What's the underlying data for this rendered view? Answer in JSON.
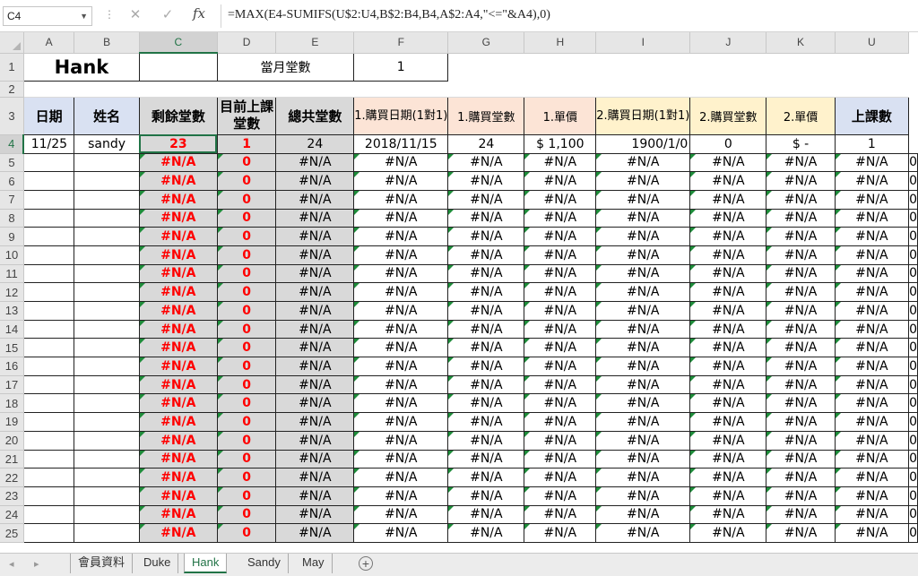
{
  "name_box": "C4",
  "formula": "=MAX(E4-SUMIFS(U$2:U4,B$2:B4,B4,A$2:A4,\"<=\"&A4),0)",
  "fx_label": "fx",
  "column_headers": [
    "A",
    "B",
    "C",
    "D",
    "E",
    "F",
    "G",
    "H",
    "I",
    "J",
    "K",
    "U"
  ],
  "row_numbers": [
    "1",
    "2",
    "3",
    "4",
    "5",
    "6",
    "7",
    "8",
    "9",
    "10",
    "11",
    "12",
    "13",
    "14",
    "15",
    "16",
    "17",
    "18",
    "19",
    "20",
    "21",
    "22",
    "23",
    "24",
    "25"
  ],
  "row1": {
    "name": "Hank",
    "label": "當月堂數",
    "value": "1"
  },
  "headers": {
    "date": "日期",
    "name": "姓名",
    "remaining": "剩餘堂數",
    "current": "目前上課堂數",
    "total": "總共堂數",
    "buy1_date": "1.購買日期(1對1)",
    "buy1_count": "1.購買堂數",
    "price1": "1.單價",
    "buy2_date": "2.購買日期(1對1)",
    "buy2_count": "2.購買堂數",
    "price2": "2.單價",
    "classes": "上課數"
  },
  "row4": {
    "date": "11/25",
    "name": "sandy",
    "remaining": "23",
    "current": "1",
    "total": "24",
    "buy1_date": "2018/11/15",
    "buy1_count": "24",
    "price1": "$ 1,100",
    "buy2_date": "1900/1/0",
    "buy2_count": "0",
    "price2": "$ -",
    "classes": "1"
  },
  "empty_row": {
    "remaining": "#N/A",
    "current": "0",
    "na": "#N/A",
    "classes": "0"
  },
  "sheet_tabs": [
    "會員資料",
    "Duke",
    "Hank",
    "Sandy",
    "May"
  ],
  "active_tab": "Hank",
  "colors": {
    "accent": "#217346",
    "red": "#ff0000",
    "gray": "#d9d9d9",
    "pink": "#fce4d6",
    "yellow": "#fff2cc",
    "blue": "#d9e1f2"
  }
}
